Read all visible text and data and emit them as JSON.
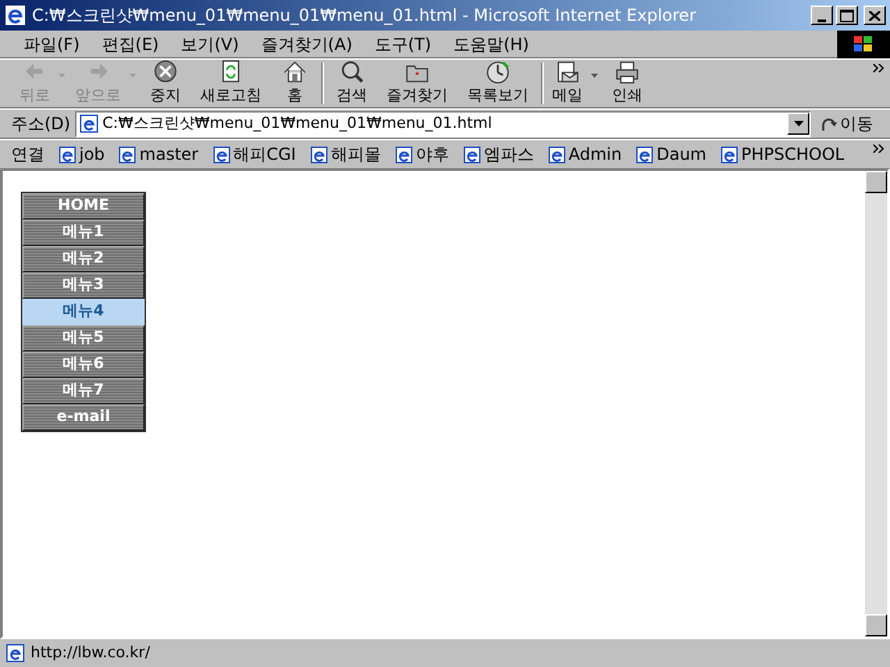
{
  "window": {
    "title": "C:₩스크린샷₩menu_01₩menu_01₩menu_01.html - Microsoft Internet Explorer"
  },
  "menu_bar": [
    "파일(F)",
    "편집(E)",
    "보기(V)",
    "즐겨찾기(A)",
    "도구(T)",
    "도움말(H)"
  ],
  "toolbar": [
    {
      "kind": "back",
      "label": "뒤로",
      "disabled": true,
      "dropdown": true
    },
    {
      "kind": "forward",
      "label": "앞으로",
      "disabled": true,
      "dropdown": true
    },
    {
      "kind": "stop",
      "label": "중지",
      "disabled": false,
      "dropdown": false
    },
    {
      "kind": "refresh",
      "label": "새로고침",
      "disabled": false,
      "dropdown": false
    },
    {
      "kind": "home",
      "label": "홈",
      "disabled": false,
      "dropdown": false
    },
    {
      "kind": "search",
      "label": "검색",
      "disabled": false,
      "dropdown": false
    },
    {
      "kind": "favorites",
      "label": "즐겨찾기",
      "disabled": false,
      "dropdown": false
    },
    {
      "kind": "history",
      "label": "목록보기",
      "disabled": false,
      "dropdown": false
    },
    {
      "kind": "mail",
      "label": "메일",
      "disabled": false,
      "dropdown": true
    },
    {
      "kind": "print",
      "label": "인쇄",
      "disabled": false,
      "dropdown": false
    }
  ],
  "address_bar": {
    "label": "주소(D)",
    "value": "C:₩스크린샷₩menu_01₩menu_01₩menu_01.html",
    "go": "이동"
  },
  "links_bar": {
    "label": "연결",
    "links": [
      "job",
      "master",
      "해피CGI",
      "해피몰",
      "야후",
      "엠파스",
      "Admin",
      "Daum",
      "PHPSCHOOL"
    ]
  },
  "page_menu": [
    {
      "label": "HOME",
      "selected": false
    },
    {
      "label": "메뉴1",
      "selected": false
    },
    {
      "label": "메뉴2",
      "selected": false
    },
    {
      "label": "메뉴3",
      "selected": false
    },
    {
      "label": "메뉴4",
      "selected": true
    },
    {
      "label": "메뉴5",
      "selected": false
    },
    {
      "label": "메뉴6",
      "selected": false
    },
    {
      "label": "메뉴7",
      "selected": false
    },
    {
      "label": "e-mail",
      "selected": false
    }
  ],
  "status_bar": {
    "text": "http://lbw.co.kr/"
  }
}
